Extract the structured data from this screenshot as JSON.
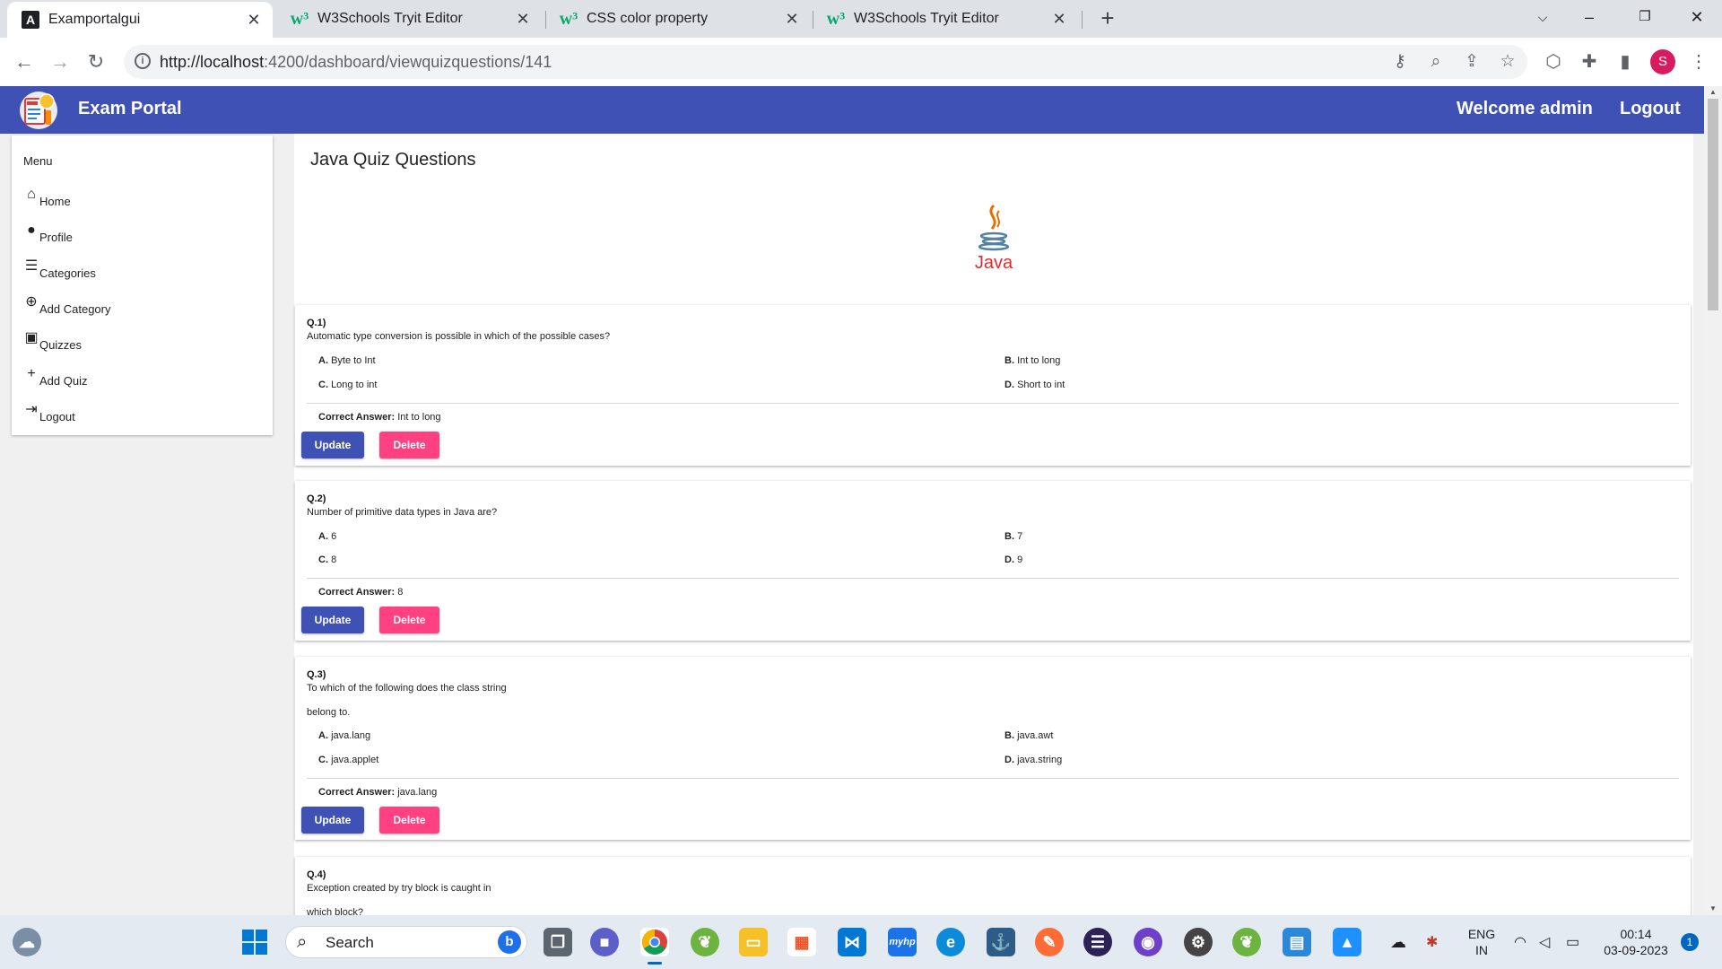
{
  "browser": {
    "tabs": [
      {
        "title": "Examportalgui",
        "icon": "angular-icon"
      },
      {
        "title": "W3Schools Tryit Editor",
        "icon": "w3schools-icon"
      },
      {
        "title": "CSS color property",
        "icon": "w3schools-icon"
      },
      {
        "title": "W3Schools Tryit Editor",
        "icon": "w3schools-icon"
      }
    ],
    "url_host": "http://localhost",
    "url_path": ":4200/dashboard/viewquizquestions/141",
    "profile_initial": "S"
  },
  "header": {
    "brand": "Exam Portal",
    "welcome": "Welcome admin",
    "logout": "Logout",
    "color": "#3f51b5"
  },
  "sidebar": {
    "title": "Menu",
    "items": [
      {
        "label": "Home",
        "icon": "home-icon"
      },
      {
        "label": "Profile",
        "icon": "account-icon"
      },
      {
        "label": "Categories",
        "icon": "list-icon"
      },
      {
        "label": "Add Category",
        "icon": "add-circle-icon"
      },
      {
        "label": "Quizzes",
        "icon": "quiz-icon"
      },
      {
        "label": "Add Quiz",
        "icon": "plus-icon"
      },
      {
        "label": "Logout",
        "icon": "logout-icon"
      }
    ]
  },
  "main": {
    "title": "Java Quiz Questions",
    "logo_text": "Java",
    "correct_label": "Correct Answer:",
    "update_label": "Update",
    "delete_label": "Delete",
    "questions": [
      {
        "num": "Q.1)",
        "text": "Automatic type conversion is possible in which of the possible cases?",
        "text2": "",
        "options": [
          {
            "key": "A.",
            "value": "Byte to Int"
          },
          {
            "key": "B.",
            "value": "Int to long"
          },
          {
            "key": "C.",
            "value": "Long to int"
          },
          {
            "key": "D.",
            "value": "Short to int"
          }
        ],
        "answer": "Int to long"
      },
      {
        "num": "Q.2)",
        "text": "Number of primitive data types in Java are?",
        "text2": "",
        "options": [
          {
            "key": "A.",
            "value": "6"
          },
          {
            "key": "B.",
            "value": "7"
          },
          {
            "key": "C.",
            "value": "8"
          },
          {
            "key": "D.",
            "value": "9"
          }
        ],
        "answer": "8"
      },
      {
        "num": "Q.3)",
        "text": "To which of the following does the class string",
        "text2": "belong to.",
        "options": [
          {
            "key": "A.",
            "value": "java.lang"
          },
          {
            "key": "B.",
            "value": "java.awt"
          },
          {
            "key": "C.",
            "value": "java.applet"
          },
          {
            "key": "D.",
            "value": "java.string"
          }
        ],
        "answer": "java.lang"
      },
      {
        "num": "Q.4)",
        "text": "Exception created by try block is caught in",
        "text2": "which block?"
      }
    ]
  },
  "taskbar": {
    "search_placeholder": "Search",
    "lang_line1": "ENG",
    "lang_line2": "IN",
    "time": "00:14",
    "date": "03-09-2023",
    "notification_count": "1"
  }
}
